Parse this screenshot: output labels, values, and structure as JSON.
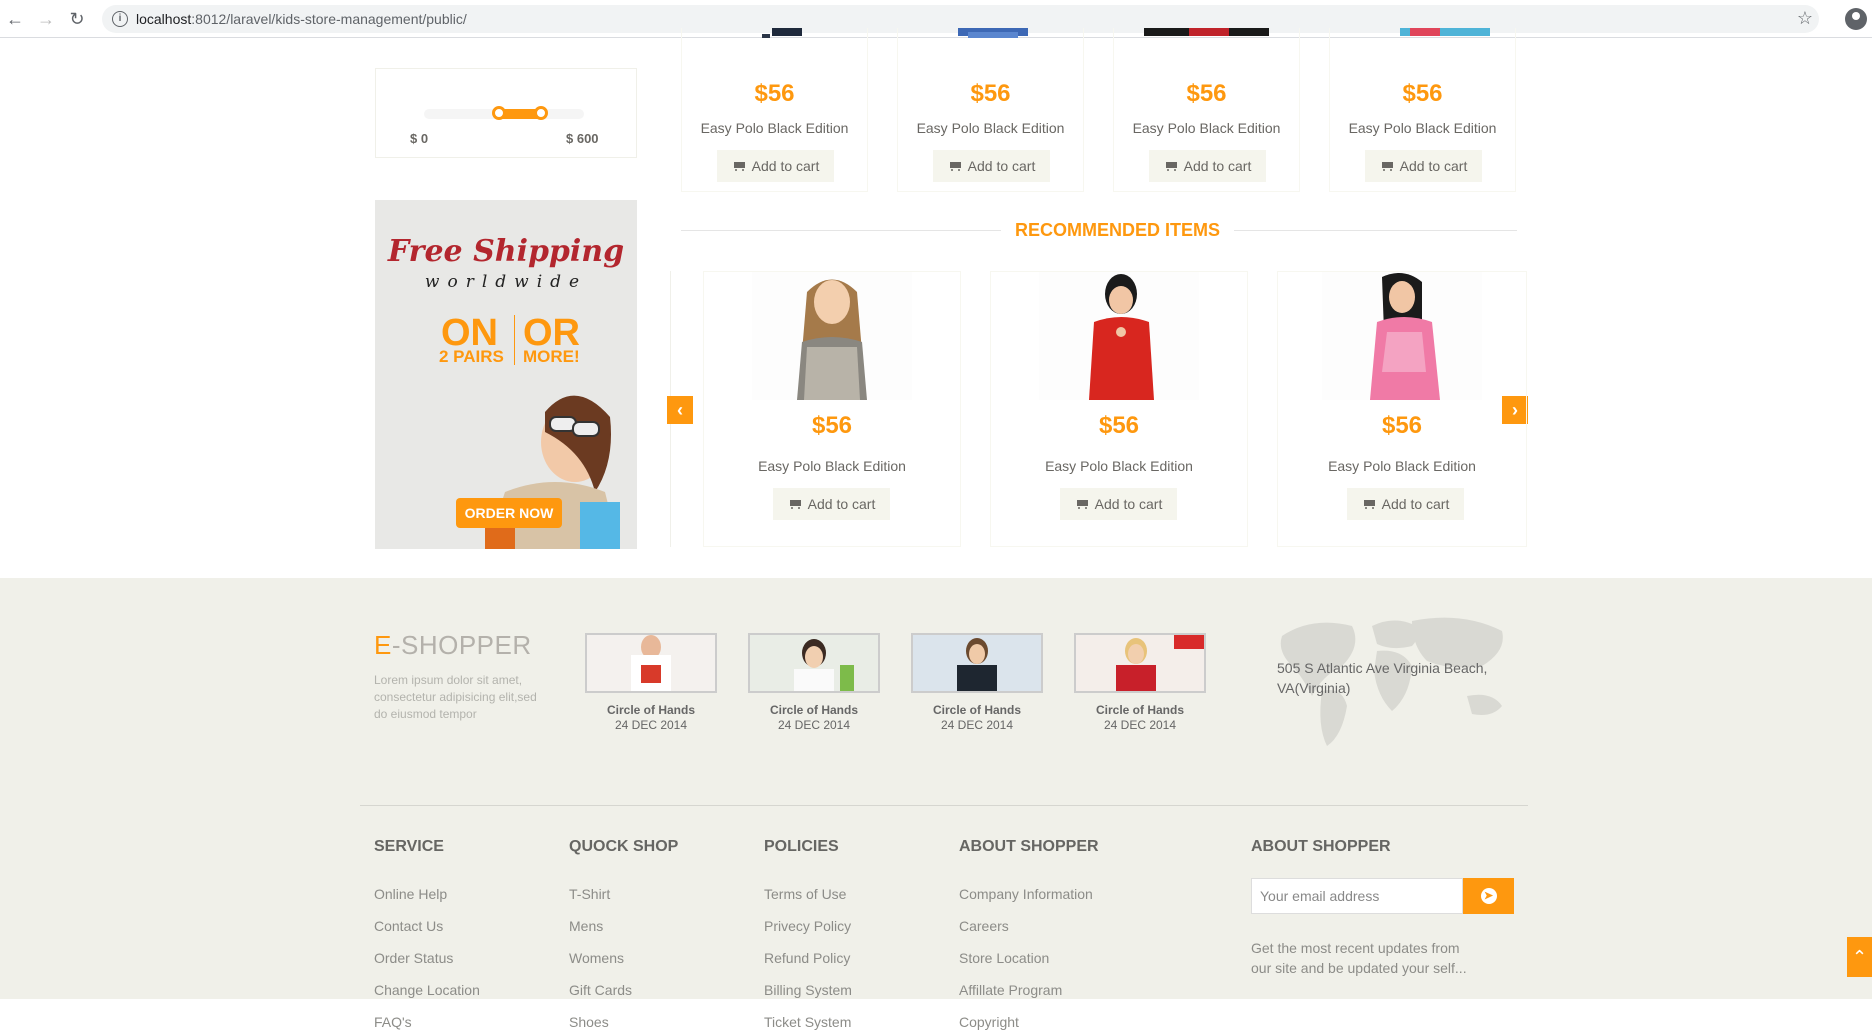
{
  "browser": {
    "url_host": "localhost",
    "url_path": ":8012/laravel/kids-store-management/public/"
  },
  "price_filter": {
    "min_label": "$ 0",
    "max_label": "$ 600"
  },
  "top_products": [
    {
      "price": "$56",
      "name": "Easy Polo Black Edition",
      "cart_label": "Add to cart"
    },
    {
      "price": "$56",
      "name": "Easy Polo Black Edition",
      "cart_label": "Add to cart"
    },
    {
      "price": "$56",
      "name": "Easy Polo Black Edition",
      "cart_label": "Add to cart"
    },
    {
      "price": "$56",
      "name": "Easy Polo Black Edition",
      "cart_label": "Add to cart"
    }
  ],
  "banner": {
    "line1": "Free Shipping",
    "line2": "worldwide",
    "on": "ON",
    "or": "OR",
    "pairs": "2 PAIRS",
    "more": "MORE!",
    "order_label": "ORDER NOW"
  },
  "recommended": {
    "title": "RECOMMENDED ITEMS",
    "items": [
      {
        "price": "$56",
        "name": "Easy Polo Black Edition",
        "cart_label": "Add to cart"
      },
      {
        "price": "$56",
        "name": "Easy Polo Black Edition",
        "cart_label": "Add to cart"
      },
      {
        "price": "$56",
        "name": "Easy Polo Black Edition",
        "cart_label": "Add to cart"
      }
    ],
    "prev_icon": "chevron-left-icon",
    "next_icon": "chevron-right-icon"
  },
  "footer": {
    "logo_e": "E",
    "logo_rest": "-SHOPPER",
    "lorem": "Lorem ipsum dolor sit amet, consectetur adipisicing elit,sed do eiusmod tempor",
    "videos": [
      {
        "title": "Circle of Hands",
        "date": "24 DEC 2014"
      },
      {
        "title": "Circle of Hands",
        "date": "24 DEC 2014"
      },
      {
        "title": "Circle of Hands",
        "date": "24 DEC 2014"
      },
      {
        "title": "Circle of Hands",
        "date": "24 DEC 2014"
      }
    ],
    "address": "505 S Atlantic Ave Virginia Beach, VA(Virginia)",
    "columns": [
      {
        "title": "SERVICE",
        "links": [
          "Online Help",
          "Contact Us",
          "Order Status",
          "Change Location",
          "FAQ's"
        ]
      },
      {
        "title": "QUOCK SHOP",
        "links": [
          "T-Shirt",
          "Mens",
          "Womens",
          "Gift Cards",
          "Shoes"
        ]
      },
      {
        "title": "POLICIES",
        "links": [
          "Terms of Use",
          "Privecy Policy",
          "Refund Policy",
          "Billing System",
          "Ticket System"
        ]
      },
      {
        "title": "ABOUT SHOPPER",
        "links": [
          "Company Information",
          "Careers",
          "Store Location",
          "Affillate Program",
          "Copyright"
        ]
      }
    ],
    "subscribe": {
      "title": "ABOUT SHOPPER",
      "placeholder": "Your email address",
      "note": "Get the most recent updates from our site and be updated your self..."
    }
  },
  "colors": {
    "accent": "#FE980F",
    "footer_bg": "#F0F0E9"
  }
}
